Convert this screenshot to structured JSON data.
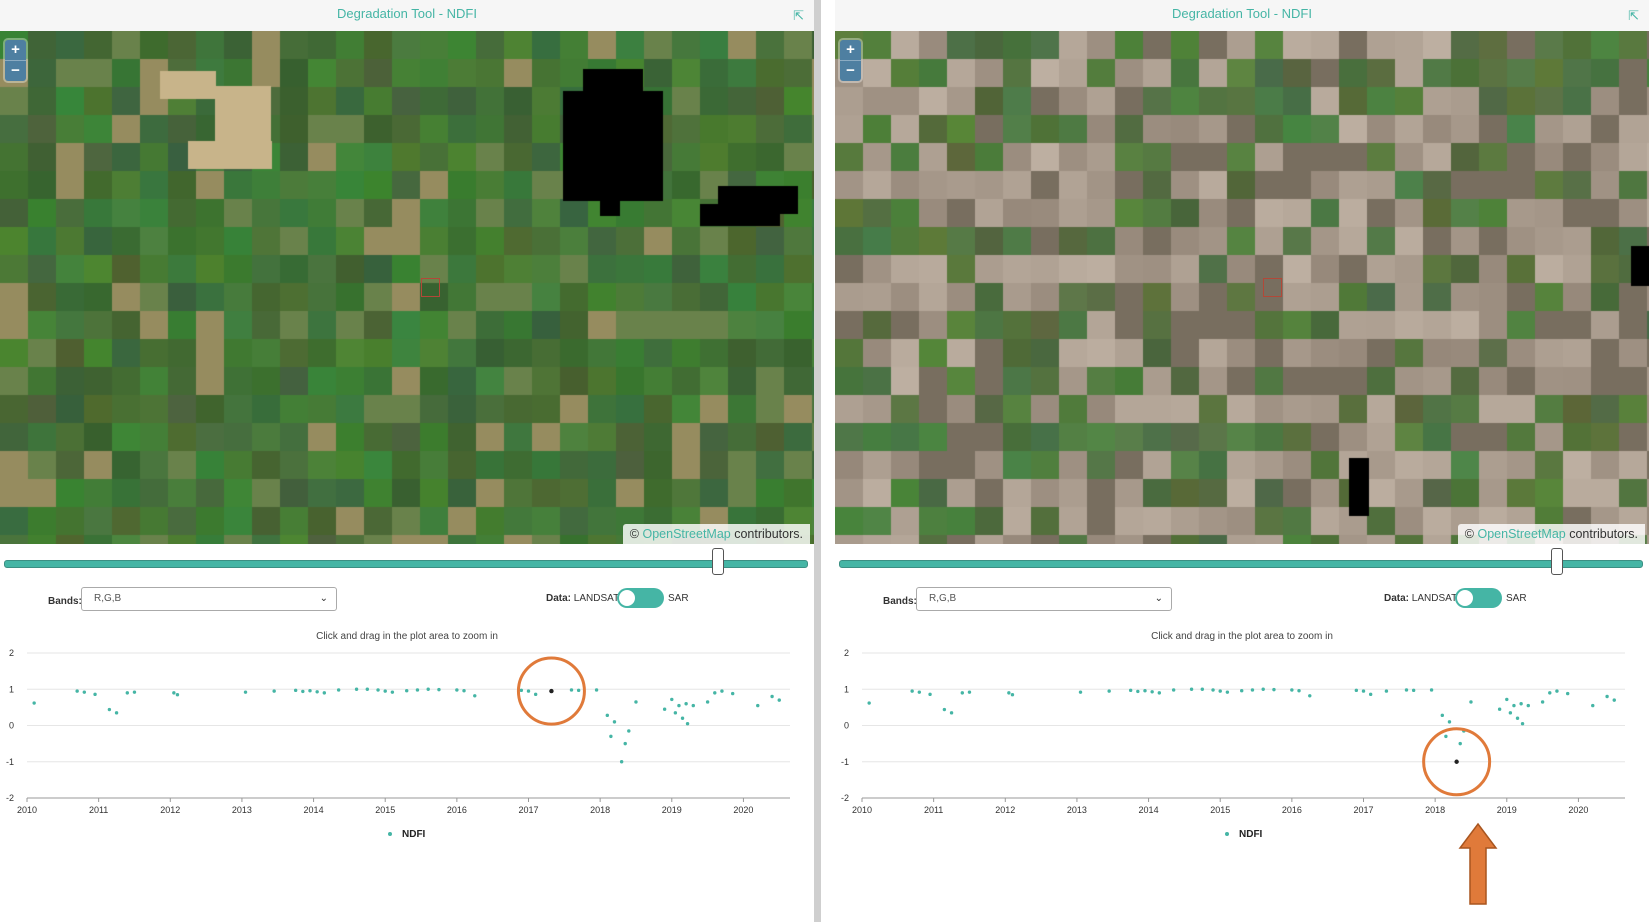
{
  "panels": [
    {
      "title": "Degradation Tool - NDFI",
      "collapse_icon": "collapse-icon",
      "zoom_in": "+",
      "zoom_out": "−",
      "attribution_prefix": "© ",
      "attribution_link": "OpenStreetMap",
      "attribution_suffix": " contributors.",
      "bands_label": "Bands:",
      "bands_value": "R,G,B",
      "data_label": "Data:",
      "data_option_left": "LANDSAT",
      "data_option_right": "SAR",
      "plot_hint": "Click and drag in the plot area to zoom in",
      "legend": "NDFI",
      "slider_value": 0.89,
      "map_tone": "forest",
      "highlight": {
        "year": 2017.32,
        "value": 0.95
      }
    },
    {
      "title": "Degradation Tool - NDFI",
      "collapse_icon": "collapse-icon",
      "zoom_in": "+",
      "zoom_out": "−",
      "attribution_prefix": "© ",
      "attribution_link": "OpenStreetMap",
      "attribution_suffix": " contributors.",
      "bands_label": "Bands:",
      "bands_value": "R,G,B",
      "data_label": "Data:",
      "data_option_left": "LANDSAT",
      "data_option_right": "SAR",
      "plot_hint": "Click and drag in the plot area to zoom in",
      "legend": "NDFI",
      "slider_value": 0.895,
      "map_tone": "degraded",
      "highlight": {
        "year": 2018.3,
        "value": -1.0
      }
    }
  ],
  "colors": {
    "accent": "#45b5a5",
    "highlight_circle": "#e07a3a",
    "arrow": "#e07a3a"
  },
  "chart_data": {
    "type": "scatter",
    "x_ticks": [
      "2010",
      "2011",
      "2012",
      "2013",
      "2014",
      "2015",
      "2016",
      "2017",
      "2018",
      "2019",
      "2020"
    ],
    "y_ticks": [
      "2",
      "1",
      "0",
      "-1",
      "-2"
    ],
    "ylim": [
      -2,
      2
    ],
    "xlim": [
      2010,
      2020.65
    ],
    "series": [
      {
        "name": "NDFI",
        "points": [
          [
            2010.1,
            0.62
          ],
          [
            2010.7,
            0.95
          ],
          [
            2010.8,
            0.92
          ],
          [
            2010.95,
            0.86
          ],
          [
            2011.15,
            0.44
          ],
          [
            2011.25,
            0.35
          ],
          [
            2011.4,
            0.9
          ],
          [
            2011.5,
            0.92
          ],
          [
            2012.05,
            0.9
          ],
          [
            2012.1,
            0.85
          ],
          [
            2013.05,
            0.92
          ],
          [
            2013.45,
            0.95
          ],
          [
            2013.75,
            0.97
          ],
          [
            2013.85,
            0.94
          ],
          [
            2013.95,
            0.96
          ],
          [
            2014.05,
            0.93
          ],
          [
            2014.15,
            0.9
          ],
          [
            2014.35,
            0.98
          ],
          [
            2014.6,
            1.0
          ],
          [
            2014.75,
            1.0
          ],
          [
            2014.9,
            0.98
          ],
          [
            2015.0,
            0.95
          ],
          [
            2015.1,
            0.92
          ],
          [
            2015.3,
            0.96
          ],
          [
            2015.45,
            0.98
          ],
          [
            2015.6,
            1.0
          ],
          [
            2015.75,
            0.99
          ],
          [
            2016.0,
            0.98
          ],
          [
            2016.1,
            0.96
          ],
          [
            2016.25,
            0.82
          ],
          [
            2016.9,
            0.97
          ],
          [
            2017.0,
            0.95
          ],
          [
            2017.1,
            0.86
          ],
          [
            2017.32,
            0.95
          ],
          [
            2017.6,
            0.98
          ],
          [
            2017.7,
            0.97
          ],
          [
            2017.95,
            0.98
          ],
          [
            2018.1,
            0.28
          ],
          [
            2018.15,
            -0.3
          ],
          [
            2018.2,
            0.1
          ],
          [
            2018.3,
            -1.0
          ],
          [
            2018.35,
            -0.5
          ],
          [
            2018.4,
            -0.15
          ],
          [
            2018.5,
            0.65
          ],
          [
            2018.9,
            0.45
          ],
          [
            2019.0,
            0.72
          ],
          [
            2019.05,
            0.35
          ],
          [
            2019.1,
            0.55
          ],
          [
            2019.15,
            0.2
          ],
          [
            2019.2,
            0.6
          ],
          [
            2019.22,
            0.05
          ],
          [
            2019.3,
            0.55
          ],
          [
            2019.5,
            0.65
          ],
          [
            2019.6,
            0.9
          ],
          [
            2019.7,
            0.95
          ],
          [
            2019.85,
            0.88
          ],
          [
            2020.2,
            0.55
          ],
          [
            2020.4,
            0.8
          ],
          [
            2020.5,
            0.7
          ]
        ]
      }
    ]
  }
}
